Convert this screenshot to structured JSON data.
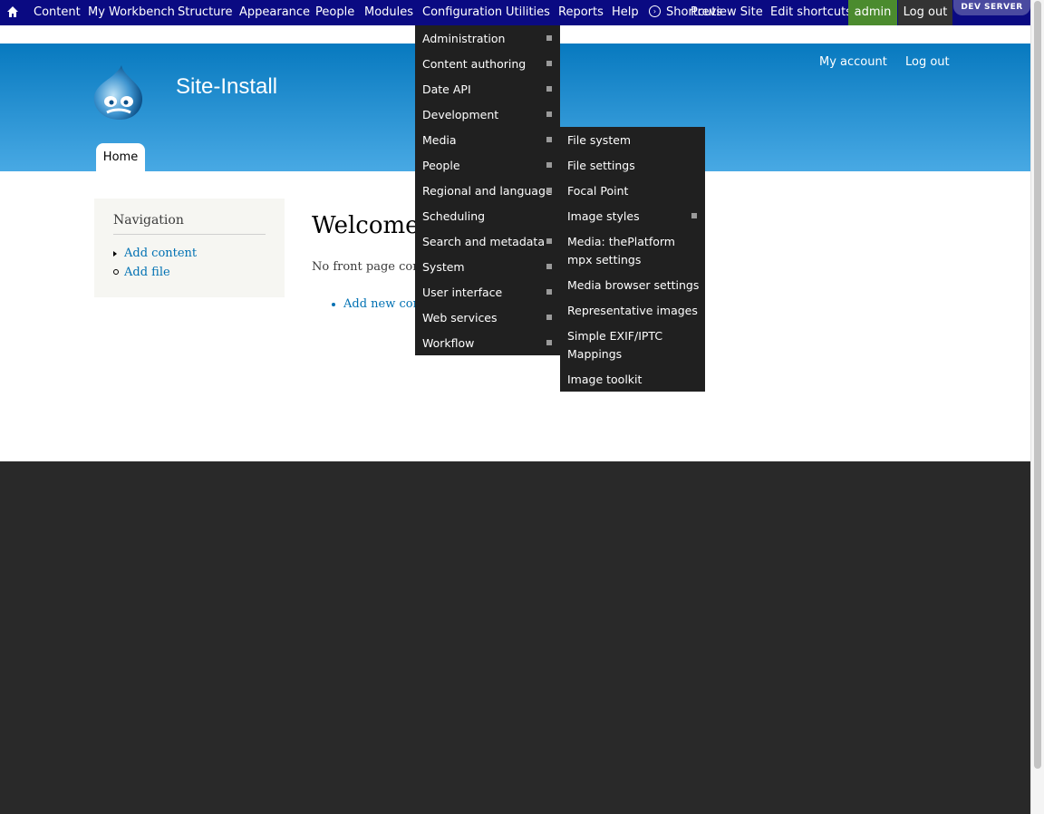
{
  "toolbar": {
    "items": [
      "Content",
      "My Workbench",
      "Structure",
      "Appearance",
      "People",
      "Modules",
      "Configuration",
      "Utilities",
      "Reports",
      "Help"
    ],
    "shortcuts": "Shortcuts",
    "preview_site": "Preview Site",
    "edit_shortcuts": "Edit shortcuts",
    "admin": "admin",
    "logout": "Log out",
    "dev_server": "DEV SERVER"
  },
  "header": {
    "site_name": "Site-Install",
    "my_account": "My account",
    "log_out": "Log out",
    "tab_home": "Home"
  },
  "sidebar": {
    "title": "Navigation",
    "links": [
      "Add content",
      "Add file"
    ]
  },
  "main": {
    "title": "Welcome",
    "message": "No front page cont",
    "add_new_content": "Add new con"
  },
  "config_menu": [
    {
      "label": "Administration",
      "has_children": true
    },
    {
      "label": "Content authoring",
      "has_children": true
    },
    {
      "label": "Date API",
      "has_children": true
    },
    {
      "label": "Development",
      "has_children": true
    },
    {
      "label": "Media",
      "has_children": true
    },
    {
      "label": "People",
      "has_children": true
    },
    {
      "label": "Regional and language",
      "has_children": true
    },
    {
      "label": "Scheduling",
      "has_children": false
    },
    {
      "label": "Search and metadata",
      "has_children": true
    },
    {
      "label": "System",
      "has_children": true
    },
    {
      "label": "User interface",
      "has_children": true
    },
    {
      "label": "Web services",
      "has_children": true
    },
    {
      "label": "Workflow",
      "has_children": true
    }
  ],
  "media_menu": [
    {
      "label": "File system",
      "has_children": false
    },
    {
      "label": "File settings",
      "has_children": false
    },
    {
      "label": "Focal Point",
      "has_children": false
    },
    {
      "label": "Image styles",
      "has_children": true
    },
    {
      "label": "Media: thePlatform mpx settings",
      "has_children": false
    },
    {
      "label": "Media browser settings",
      "has_children": false
    },
    {
      "label": "Representative images",
      "has_children": false
    },
    {
      "label": "Simple EXIF/IPTC Mappings",
      "has_children": false
    },
    {
      "label": "Image toolkit",
      "has_children": false
    }
  ],
  "colors": {
    "toolbar_bg": "#0a0a82",
    "header_gradient_top": "#0779bf",
    "header_gradient_bottom": "#48a9e4",
    "admin_bg": "#4b8b2e",
    "menu_bg": "#202020",
    "link": "#0071b3",
    "footer_bg": "#292929"
  },
  "icons": {
    "home": "home-icon",
    "logo": "drupal-drop-logo",
    "shortcuts": "chevron-circle-icon"
  }
}
